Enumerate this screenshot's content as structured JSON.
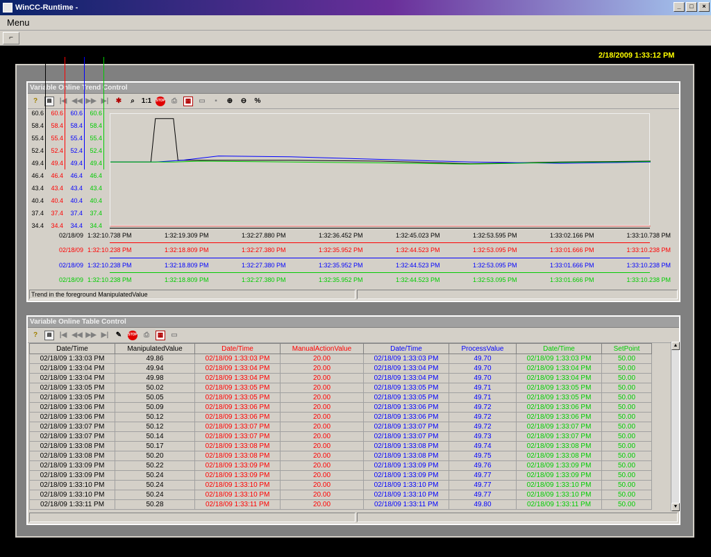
{
  "window": {
    "title": "WinCC-Runtime -",
    "buttons": [
      "_",
      "□",
      "×"
    ]
  },
  "menu": {
    "label": "Menu"
  },
  "toolbar": {
    "button": "⌐"
  },
  "datetime": "2/18/2009 1:33:12 PM",
  "trend": {
    "title": "Variable Online Trend Control",
    "status": "Trend in the foreground ManipulatedValue",
    "axis_labels": [
      "60.6",
      "58.4",
      "55.4",
      "52.4",
      "49.4",
      "46.4",
      "43.4",
      "40.4",
      "37.4",
      "34.4"
    ],
    "axis_colors": [
      "#000000",
      "#ff0000",
      "#0000ff",
      "#00cc00"
    ],
    "time_rows": [
      {
        "date": "02/18/09",
        "color": "#000000",
        "labels": [
          "1:32:10.738 PM",
          "1:32:19.309 PM",
          "1:32:27.880 PM",
          "1:32:36.452 PM",
          "1:32:45.023 PM",
          "1:32:53.595 PM",
          "1:33:02.166 PM",
          "1:33:10.738 PM"
        ]
      },
      {
        "date": "02/18/09",
        "color": "#ff0000",
        "labels": [
          "1:32:10.238 PM",
          "1:32:18.809 PM",
          "1:32:27.380 PM",
          "1:32:35.952 PM",
          "1:32:44.523 PM",
          "1:32:53.095 PM",
          "1:33:01.666 PM",
          "1:33:10.238 PM"
        ]
      },
      {
        "date": "02/18/09",
        "color": "#0000ff",
        "labels": [
          "1:32:10.238 PM",
          "1:32:18.809 PM",
          "1:32:27.380 PM",
          "1:32:35.952 PM",
          "1:32:44.523 PM",
          "1:32:53.095 PM",
          "1:33:01.666 PM",
          "1:33:10.238 PM"
        ]
      },
      {
        "date": "02/18/09",
        "color": "#00cc00",
        "labels": [
          "1:32:10.238 PM",
          "1:32:18.809 PM",
          "1:32:27.380 PM",
          "1:32:35.952 PM",
          "1:32:44.523 PM",
          "1:32:53.095 PM",
          "1:33:01.666 PM",
          "1:33:10.238 PM"
        ]
      }
    ],
    "toolbar_icons": [
      "help-icon",
      "config-icon",
      "first-icon",
      "prev-icon",
      "next-icon",
      "last-icon",
      "ruler-icon",
      "zoom-icon",
      "original-size-icon",
      "stop-icon",
      "print-icon",
      "select-data-icon",
      "export-icon",
      "save-icon",
      "zoom-in-icon",
      "zoom-out-icon",
      "percent-icon"
    ],
    "toolbar_glyphs": {
      "help": "?",
      "zoom": "🔍",
      "one_to_one": "1:1",
      "stop": "STOP",
      "percent": "%"
    }
  },
  "chart_data": {
    "type": "line",
    "ylim": [
      34.4,
      60.6
    ],
    "x_range": [
      "1:32:10.738 PM",
      "1:33:10.738 PM"
    ],
    "series": [
      {
        "name": "ManipulatedValue",
        "color": "#000000",
        "x": [
          0,
          4.5,
          5.0,
          7.0,
          7.5,
          10,
          20,
          30,
          40,
          50,
          60
        ],
        "y": [
          49.4,
          49.4,
          59.5,
          59.5,
          49.8,
          49.8,
          49.8,
          49.6,
          49.0,
          49.4,
          49.6
        ]
      },
      {
        "name": "ManualActionValue",
        "color": "#ff0000",
        "x": [
          0,
          60
        ],
        "y": [
          20.0,
          20.0
        ]
      },
      {
        "name": "ProcessValue",
        "color": "#0000ff",
        "x": [
          0,
          5,
          8,
          12,
          20,
          30,
          40,
          50,
          60
        ],
        "y": [
          49.4,
          49.4,
          49.8,
          50.8,
          50.6,
          50.0,
          49.4,
          49.1,
          49.4
        ]
      },
      {
        "name": "SetPoint",
        "color": "#00cc00",
        "x": [
          0,
          7,
          10,
          20,
          30,
          40,
          50,
          60
        ],
        "y": [
          49.4,
          49.4,
          49.6,
          49.4,
          49.2,
          48.9,
          49.3,
          49.5
        ]
      }
    ]
  },
  "table": {
    "title": "Variable Online Table Control",
    "toolbar_glyphs": {
      "help": "?",
      "edit": "✎",
      "stop": "STOP"
    },
    "columns": [
      {
        "label": "Date/Time",
        "color": "#000000"
      },
      {
        "label": "ManipulatedValue",
        "color": "#000000"
      },
      {
        "label": "Date/Time",
        "color": "#ff0000"
      },
      {
        "label": "ManualActionValue",
        "color": "#ff0000"
      },
      {
        "label": "Date/Time",
        "color": "#0000ff"
      },
      {
        "label": "ProcessValue",
        "color": "#0000ff"
      },
      {
        "label": "Date/Time",
        "color": "#00cc00"
      },
      {
        "label": "SetPoint",
        "color": "#00cc00"
      }
    ],
    "rows": [
      [
        "02/18/09 1:33:03 PM",
        "49.86",
        "02/18/09 1:33:03 PM",
        "20.00",
        "02/18/09 1:33:03 PM",
        "49.70",
        "02/18/09 1:33:03 PM",
        "50.00"
      ],
      [
        "02/18/09 1:33:04 PM",
        "49.94",
        "02/18/09 1:33:04 PM",
        "20.00",
        "02/18/09 1:33:04 PM",
        "49.70",
        "02/18/09 1:33:04 PM",
        "50.00"
      ],
      [
        "02/18/09 1:33:04 PM",
        "49.98",
        "02/18/09 1:33:04 PM",
        "20.00",
        "02/18/09 1:33:04 PM",
        "49.70",
        "02/18/09 1:33:04 PM",
        "50.00"
      ],
      [
        "02/18/09 1:33:05 PM",
        "50.02",
        "02/18/09 1:33:05 PM",
        "20.00",
        "02/18/09 1:33:05 PM",
        "49.71",
        "02/18/09 1:33:05 PM",
        "50.00"
      ],
      [
        "02/18/09 1:33:05 PM",
        "50.05",
        "02/18/09 1:33:05 PM",
        "20.00",
        "02/18/09 1:33:05 PM",
        "49.71",
        "02/18/09 1:33:05 PM",
        "50.00"
      ],
      [
        "02/18/09 1:33:06 PM",
        "50.09",
        "02/18/09 1:33:06 PM",
        "20.00",
        "02/18/09 1:33:06 PM",
        "49.72",
        "02/18/09 1:33:06 PM",
        "50.00"
      ],
      [
        "02/18/09 1:33:06 PM",
        "50.12",
        "02/18/09 1:33:06 PM",
        "20.00",
        "02/18/09 1:33:06 PM",
        "49.72",
        "02/18/09 1:33:06 PM",
        "50.00"
      ],
      [
        "02/18/09 1:33:07 PM",
        "50.12",
        "02/18/09 1:33:07 PM",
        "20.00",
        "02/18/09 1:33:07 PM",
        "49.72",
        "02/18/09 1:33:07 PM",
        "50.00"
      ],
      [
        "02/18/09 1:33:07 PM",
        "50.14",
        "02/18/09 1:33:07 PM",
        "20.00",
        "02/18/09 1:33:07 PM",
        "49.73",
        "02/18/09 1:33:07 PM",
        "50.00"
      ],
      [
        "02/18/09 1:33:08 PM",
        "50.17",
        "02/18/09 1:33:08 PM",
        "20.00",
        "02/18/09 1:33:08 PM",
        "49.74",
        "02/18/09 1:33:08 PM",
        "50.00"
      ],
      [
        "02/18/09 1:33:08 PM",
        "50.20",
        "02/18/09 1:33:08 PM",
        "20.00",
        "02/18/09 1:33:08 PM",
        "49.75",
        "02/18/09 1:33:08 PM",
        "50.00"
      ],
      [
        "02/18/09 1:33:09 PM",
        "50.22",
        "02/18/09 1:33:09 PM",
        "20.00",
        "02/18/09 1:33:09 PM",
        "49.76",
        "02/18/09 1:33:09 PM",
        "50.00"
      ],
      [
        "02/18/09 1:33:09 PM",
        "50.24",
        "02/18/09 1:33:09 PM",
        "20.00",
        "02/18/09 1:33:09 PM",
        "49.77",
        "02/18/09 1:33:09 PM",
        "50.00"
      ],
      [
        "02/18/09 1:33:10 PM",
        "50.24",
        "02/18/09 1:33:10 PM",
        "20.00",
        "02/18/09 1:33:10 PM",
        "49.77",
        "02/18/09 1:33:10 PM",
        "50.00"
      ],
      [
        "02/18/09 1:33:10 PM",
        "50.24",
        "02/18/09 1:33:10 PM",
        "20.00",
        "02/18/09 1:33:10 PM",
        "49.77",
        "02/18/09 1:33:10 PM",
        "50.00"
      ],
      [
        "02/18/09 1:33:11 PM",
        "50.28",
        "02/18/09 1:33:11 PM",
        "20.00",
        "02/18/09 1:33:11 PM",
        "49.80",
        "02/18/09 1:33:11 PM",
        "50.00"
      ]
    ]
  }
}
